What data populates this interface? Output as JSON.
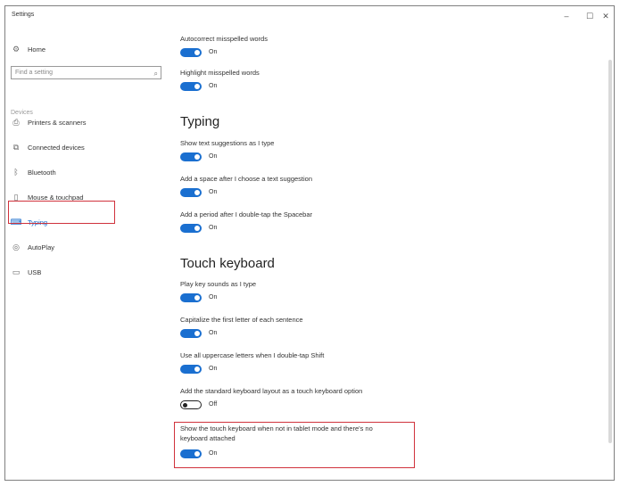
{
  "window": {
    "title": "Settings",
    "minimize": "–",
    "maximize": "☐",
    "close": "✕"
  },
  "sidebar": {
    "home": "Home",
    "search_placeholder": "Find a setting",
    "section": "Devices",
    "items": [
      {
        "label": "Printers & scanners",
        "icon": "printer-icon"
      },
      {
        "label": "Connected devices",
        "icon": "connected-devices-icon"
      },
      {
        "label": "Bluetooth",
        "icon": "bluetooth-icon"
      },
      {
        "label": "Mouse & touchpad",
        "icon": "mouse-icon"
      },
      {
        "label": "Typing",
        "icon": "keyboard-icon",
        "active": true
      },
      {
        "label": "AutoPlay",
        "icon": "autoplay-icon"
      },
      {
        "label": "USB",
        "icon": "usb-icon"
      }
    ]
  },
  "content": {
    "autocorrect": {
      "label": "Autocorrect misspelled words",
      "state": "On"
    },
    "highlight": {
      "label": "Highlight misspelled words",
      "state": "On"
    },
    "typing_heading": "Typing",
    "suggestions": {
      "label": "Show text suggestions as I type",
      "state": "On"
    },
    "add_space": {
      "label": "Add a space after I choose a text suggestion",
      "state": "On"
    },
    "add_period": {
      "label": "Add a period after I double-tap the Spacebar",
      "state": "On"
    },
    "touch_heading": "Touch keyboard",
    "key_sounds": {
      "label": "Play key sounds as I type",
      "state": "On"
    },
    "capitalize": {
      "label": "Capitalize the first letter of each sentence",
      "state": "On"
    },
    "uppercase": {
      "label": "Use all uppercase letters when I double-tap Shift",
      "state": "On"
    },
    "standard_layout": {
      "label": "Add the standard keyboard layout as a touch keyboard option",
      "state": "Off"
    },
    "show_touch_keyboard": {
      "label_line1": "Show the touch keyboard when not in tablet mode and there's no",
      "label_line2": "keyboard attached",
      "state": "On"
    }
  },
  "colors": {
    "accent": "#1a6fd0",
    "highlight_border": "#d0323c"
  }
}
